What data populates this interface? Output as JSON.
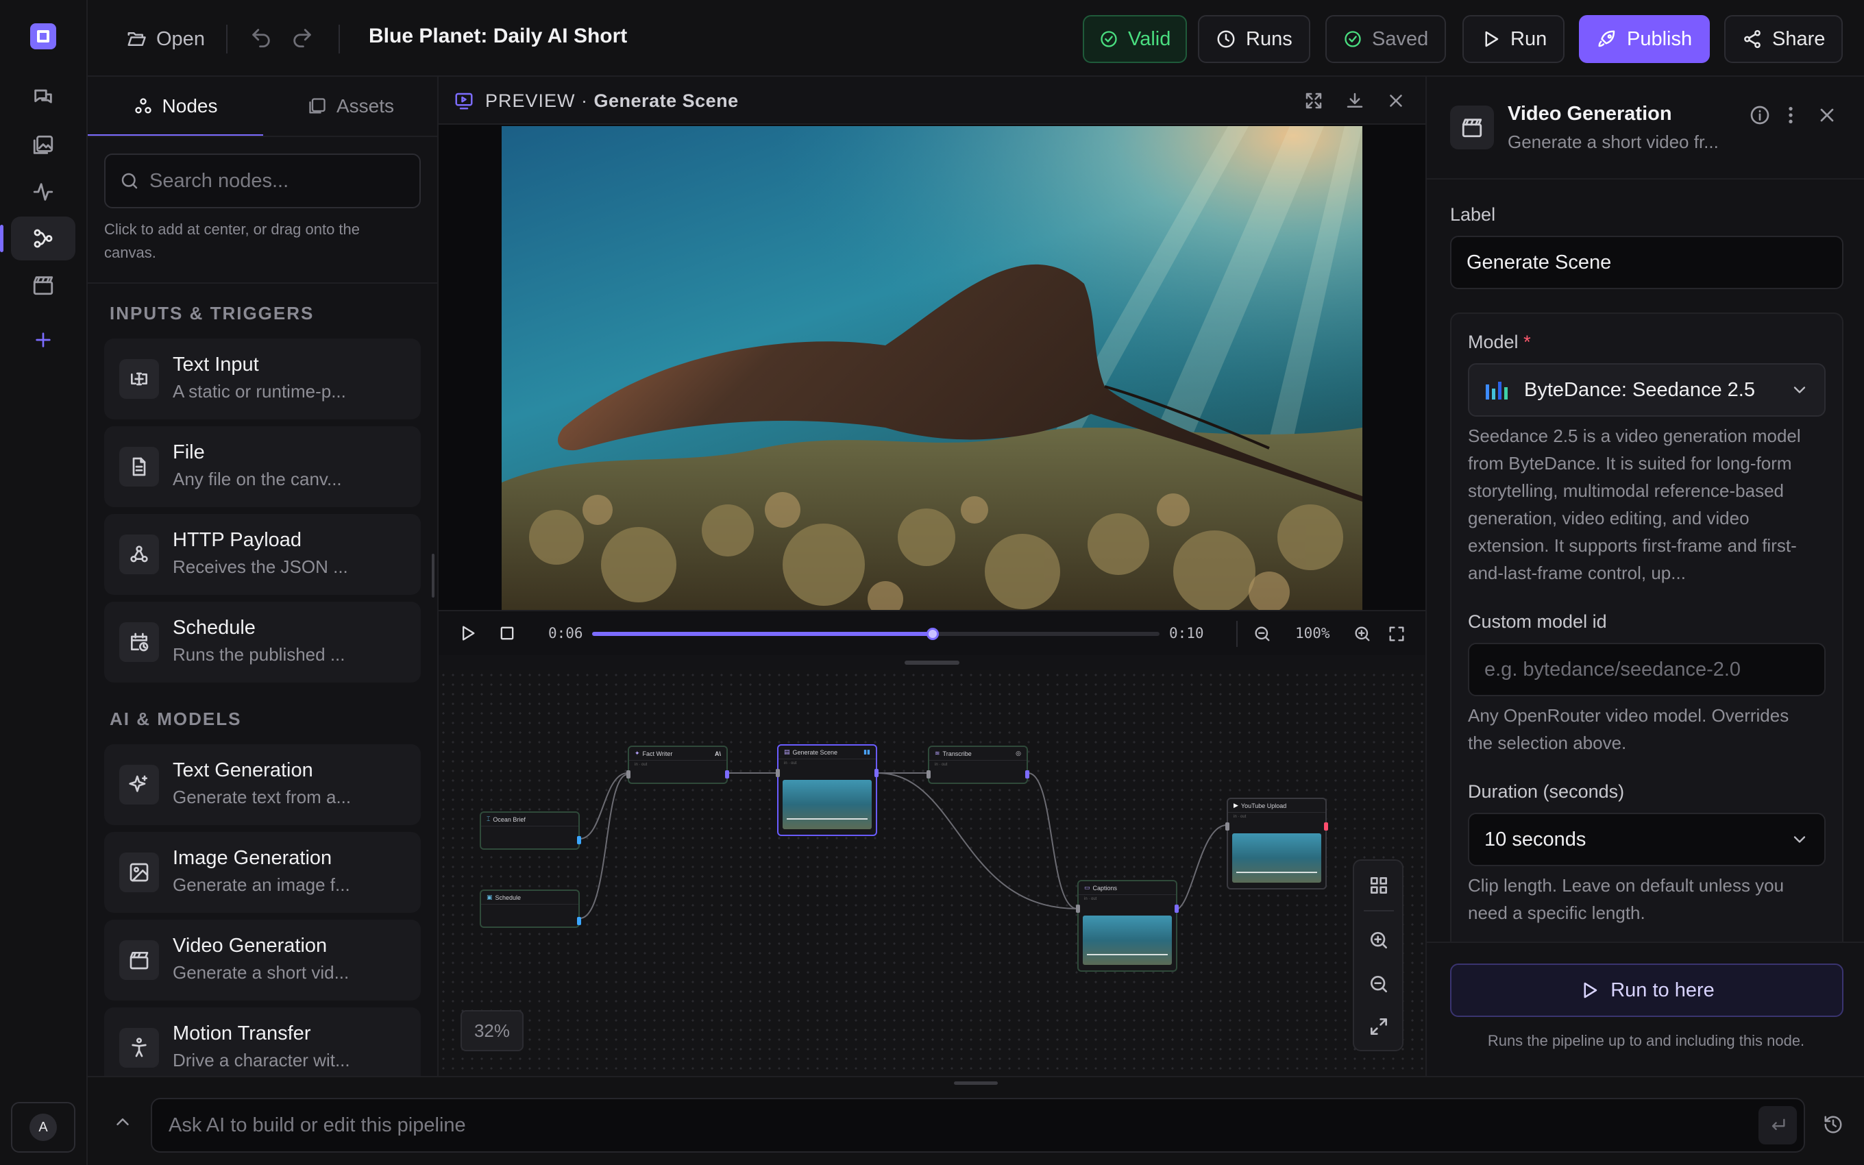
{
  "app": {
    "title": "Blue Planet: Daily AI Short",
    "accent": "#7c6cff",
    "user_initial": "A"
  },
  "rail": {
    "items": [
      {
        "name": "chat",
        "icon": "chat-icon"
      },
      {
        "name": "gallery",
        "icon": "gallery-icon"
      },
      {
        "name": "activity",
        "icon": "activity-icon"
      },
      {
        "name": "pipelines",
        "icon": "pipeline-icon",
        "active": true
      },
      {
        "name": "clips",
        "icon": "clapperboard-icon"
      },
      {
        "name": "add",
        "icon": "plus-icon"
      }
    ]
  },
  "toolbar": {
    "open_label": "Open",
    "valid_label": "Valid",
    "runs_label": "Runs",
    "saved_label": "Saved",
    "run_label": "Run",
    "publish_label": "Publish",
    "share_label": "Share"
  },
  "left_panel": {
    "tabs": [
      {
        "label": "Nodes",
        "active": true
      },
      {
        "label": "Assets",
        "active": false
      }
    ],
    "search_placeholder": "Search nodes...",
    "hint": "Click to add at center, or drag onto the canvas.",
    "sections": [
      {
        "title": "INPUTS & TRIGGERS",
        "items": [
          {
            "title": "Text Input",
            "desc": "A static or runtime-p...",
            "icon": "text-input-icon"
          },
          {
            "title": "File",
            "desc": "Any file on the canv...",
            "icon": "file-icon"
          },
          {
            "title": "HTTP Payload",
            "desc": "Receives the JSON ...",
            "icon": "webhook-icon"
          },
          {
            "title": "Schedule",
            "desc": "Runs the published ...",
            "icon": "calendar-clock-icon"
          }
        ]
      },
      {
        "title": "AI & MODELS",
        "items": [
          {
            "title": "Text Generation",
            "desc": "Generate text from a...",
            "icon": "sparkles-icon"
          },
          {
            "title": "Image Generation",
            "desc": "Generate an image f...",
            "icon": "image-icon"
          },
          {
            "title": "Video Generation",
            "desc": "Generate a short vid...",
            "icon": "clapperboard-icon"
          },
          {
            "title": "Motion Transfer",
            "desc": "Drive a character wit...",
            "icon": "person-motion-icon"
          }
        ]
      }
    ]
  },
  "preview": {
    "prefix": "PREVIEW",
    "node_name": "Generate Scene",
    "current_time": "0:06",
    "duration": "0:10",
    "progress": 0.6,
    "zoom": "100%"
  },
  "canvas": {
    "zoom": "32%",
    "nodes": [
      {
        "id": "ocean-brief",
        "label": "Ocean Brief"
      },
      {
        "id": "schedule",
        "label": "Schedule"
      },
      {
        "id": "fact-writer",
        "label": "Fact Writer"
      },
      {
        "id": "generate-scene",
        "label": "Generate Scene"
      },
      {
        "id": "transcribe",
        "label": "Transcribe"
      },
      {
        "id": "captions",
        "label": "Captions"
      },
      {
        "id": "youtube-upload",
        "label": "YouTube Upload"
      }
    ]
  },
  "inspector": {
    "title": "Video Generation",
    "subtitle": "Generate a short video fr...",
    "label_field_label": "Label",
    "label_value": "Generate Scene",
    "model_label": "Model",
    "required_mark": "*",
    "model_value": "ByteDance: Seedance 2.5",
    "model_help_lines": [
      "Seedance 2.5 is a video generation model",
      "from ByteDance. It is suited for long-form",
      "storytelling, multimodal reference-based",
      "generation, video editing, and video",
      "extension. It supports first-frame and first-",
      "and-last-frame control, up..."
    ],
    "custom_model_label": "Custom model id",
    "custom_model_placeholder": "e.g. bytedance/seedance-2.0",
    "custom_model_help_lines": [
      "Any OpenRouter video model. Overrides",
      "the selection above."
    ],
    "duration_label": "Duration (seconds)",
    "duration_value": "10 seconds",
    "duration_help_lines": [
      "Clip length. Leave on default unless you",
      "need a specific length."
    ],
    "run_to_here_label": "Run to here",
    "run_to_here_help": "Runs the pipeline up to and including this node."
  },
  "ai_bar": {
    "placeholder": "Ask AI to build or edit this pipeline"
  }
}
